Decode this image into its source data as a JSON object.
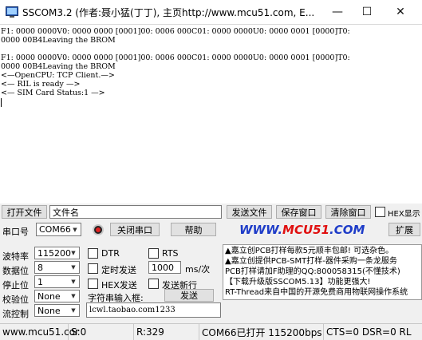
{
  "window": {
    "title": "SSCOM3.2 (作者:聂小猛(丁丁), 主页http://www.mcu51.com,  E...",
    "min_glyph": "—",
    "max_glyph": "☐",
    "close_glyph": "✕"
  },
  "receive": {
    "lines": [
      "F1: 0000 0000V0: 0000 0000 [0001]00: 0006 000C01: 0000 0000U0: 0000 0001 [0000]T0:",
      "0000 00B4Leaving the BROM",
      "",
      "F1: 0000 0000V0: 0000 0000 [0001]00: 0006 000C01: 0000 0000U0: 0000 0001 [0000]T0:",
      "0000 00B4Leaving the BROM",
      "<—OpenCPU: TCP Client.—>",
      "<— RIL is ready —>",
      "<— SIM Card Status:1 —>"
    ]
  },
  "file_row": {
    "open_file": "打开文件",
    "filename_value": "文件名",
    "send_file": "发送文件",
    "save_window": "保存窗口",
    "clear_window": "清除窗口",
    "hex_display": "HEX显示"
  },
  "port_row": {
    "port_label": "串口号",
    "port_value": "COM66",
    "close_port": "关闭串口",
    "help": "帮助",
    "brand_left": "WWW.",
    "brand_mid": "MCU51",
    "brand_right": ".COM",
    "expand": "扩展"
  },
  "settings": {
    "baud_label": "波特率",
    "baud_value": "115200",
    "databits_label": "数据位",
    "databits_value": "8",
    "stopbits_label": "停止位",
    "stopbits_value": "1",
    "parity_label": "校验位",
    "parity_value": "None",
    "flow_label": "流控制",
    "flow_value": "None"
  },
  "options": {
    "dtr": "DTR",
    "rts": "RTS",
    "timed_send": "定时发送",
    "interval_value": "1000",
    "interval_unit": "ms/次",
    "hex_send": "HEX发送",
    "send_newline": "发送新行",
    "input_label": "字符串输入框:",
    "send": "发送",
    "input_value": "lcwl.taobao.com1233"
  },
  "ads": [
    "▲嘉立创PCB打样每款5元顺丰包邮! 可选杂色。",
    "▲嘉立创提供PCB-SMT打样-器件采购一条龙服务",
    "PCB打样请加F助理的QQ:800058315(不懂技术)",
    "【下载升级版SSCOM5.13】功能更强大!",
    "RT-Thread来自中国的开源免费商用物联网操作系统"
  ],
  "status": {
    "site": "www.mcu51.cor",
    "sent": "S:0",
    "received": "R:329",
    "port_state": "COM66已打开  115200bps",
    "lines": "CTS=0 DSR=0 RL"
  }
}
